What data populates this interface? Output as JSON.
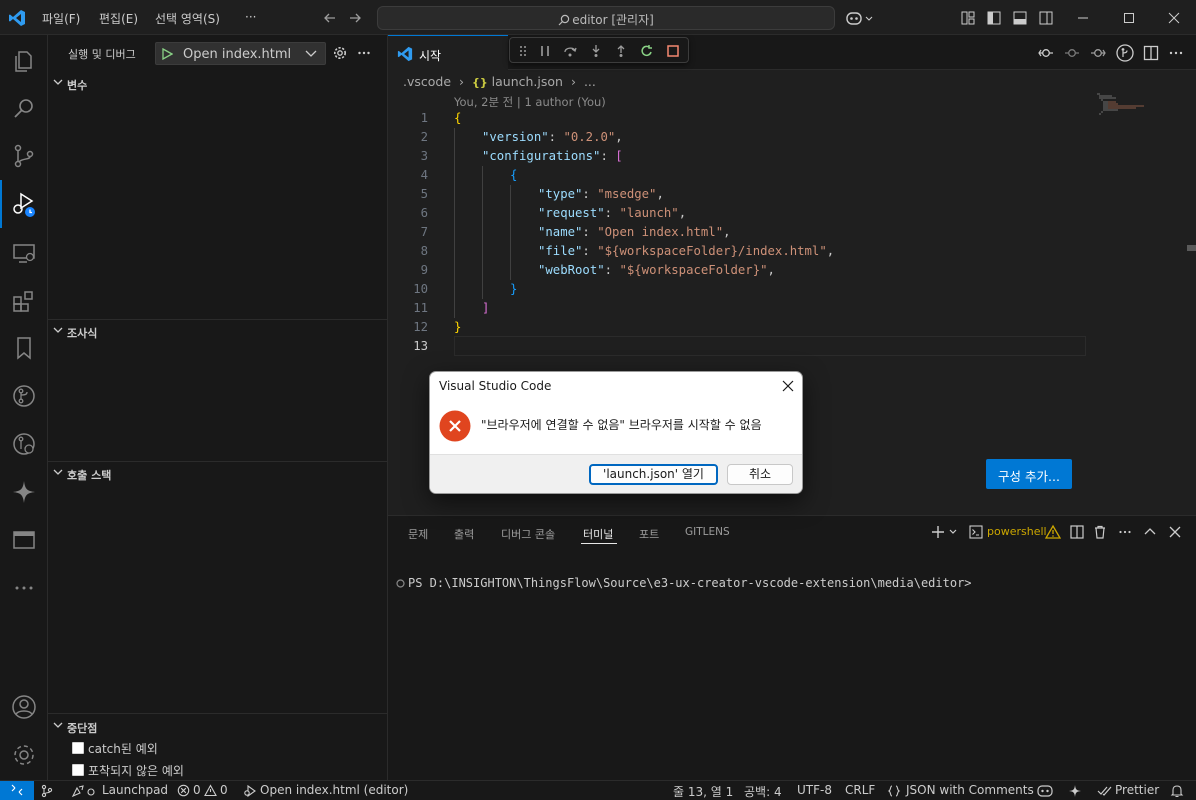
{
  "titlebar": {
    "menus": [
      "파일(F)",
      "편집(E)",
      "선택 영역(S)",
      "···"
    ],
    "search_text": "editor [관리자]"
  },
  "sidebar": {
    "header": "실행 및 디버그",
    "config_name": "Open index.html",
    "sections": {
      "variables": "변수",
      "watch": "조사식",
      "callstack": "호출 스택",
      "breakpoints": "중단점"
    },
    "breakpoint_items": [
      "catch된 예외",
      "포착되지 않은 예외"
    ]
  },
  "editor": {
    "tab_label": "시작",
    "breadcrumb": [
      ".vscode",
      "launch.json",
      "..."
    ],
    "blame": "You, 2분 전 | 1 author (You)",
    "line_numbers": [
      "1",
      "2",
      "3",
      "4",
      "5",
      "6",
      "7",
      "8",
      "9",
      "10",
      "11",
      "12",
      "13"
    ],
    "code": {
      "version_key": "\"version\"",
      "version_val": "\"0.2.0\"",
      "configs_key": "\"configurations\"",
      "type_key": "\"type\"",
      "type_val": "\"msedge\"",
      "request_key": "\"request\"",
      "request_val": "\"launch\"",
      "name_key": "\"name\"",
      "name_val": "\"Open index.html\"",
      "file_key": "\"file\"",
      "file_val": "\"${workspaceFolder}/index.html\"",
      "webroot_key": "\"webRoot\"",
      "webroot_val": "\"${workspaceFolder}\""
    },
    "add_config_button": "구성 추가..."
  },
  "dialog": {
    "title": "Visual Studio Code",
    "message": "\"브라우저에 연결할 수 없음\" 브라우저를 시작할 수 없음",
    "open_button": "'launch.json' 열기",
    "cancel_button": "취소"
  },
  "panel": {
    "tabs": [
      "문제",
      "출력",
      "디버그 콘솔",
      "터미널",
      "포트",
      "GITLENS"
    ],
    "active_tab": "터미널",
    "terminal_name": "powershell",
    "terminal_line": "PS D:\\INSIGHTON\\ThingsFlow\\Source\\e3-ux-creator-vscode-extension\\media\\editor>"
  },
  "statusbar": {
    "launchpad": "Launchpad",
    "errors": "0",
    "warnings": "0",
    "debug_target": "Open index.html (editor)",
    "cursor": "줄 13, 열 1",
    "spaces": "공백: 4",
    "encoding": "UTF-8",
    "eol": "CRLF",
    "language": "JSON with Comments",
    "prettier": "Prettier"
  },
  "colors": {
    "accent": "#0078d4",
    "error": "#e81123",
    "warning": "#cca700"
  }
}
